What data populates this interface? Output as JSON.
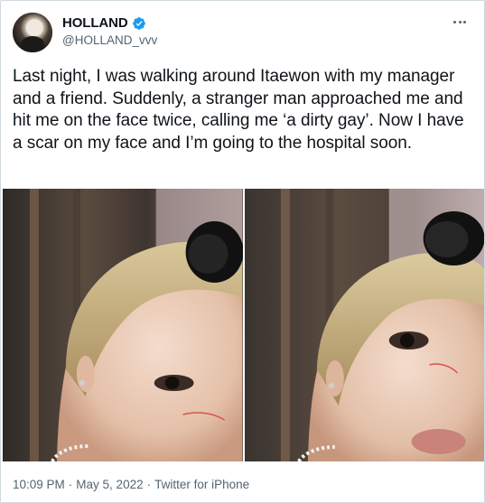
{
  "user": {
    "display_name": "HOLLAND",
    "handle": "@HOLLAND_vvv",
    "verified_icon": "verified-badge-icon",
    "verified_color": "#1d9bf0"
  },
  "tweet": {
    "text": "Last night, I was walking around Itaewon with my manager and a friend. Suddenly, a stranger man approached me and hit me on the face twice, calling me ‘a dirty gay’. Now I have a scar on my face and I’m going to the hospital soon."
  },
  "meta": {
    "time": "10:09 PM",
    "date": "May 5, 2022",
    "source": "Twitter for iPhone",
    "separator": "·"
  },
  "colors": {
    "text": "#0f1419",
    "secondary": "#536471",
    "border": "#cfd9de"
  }
}
